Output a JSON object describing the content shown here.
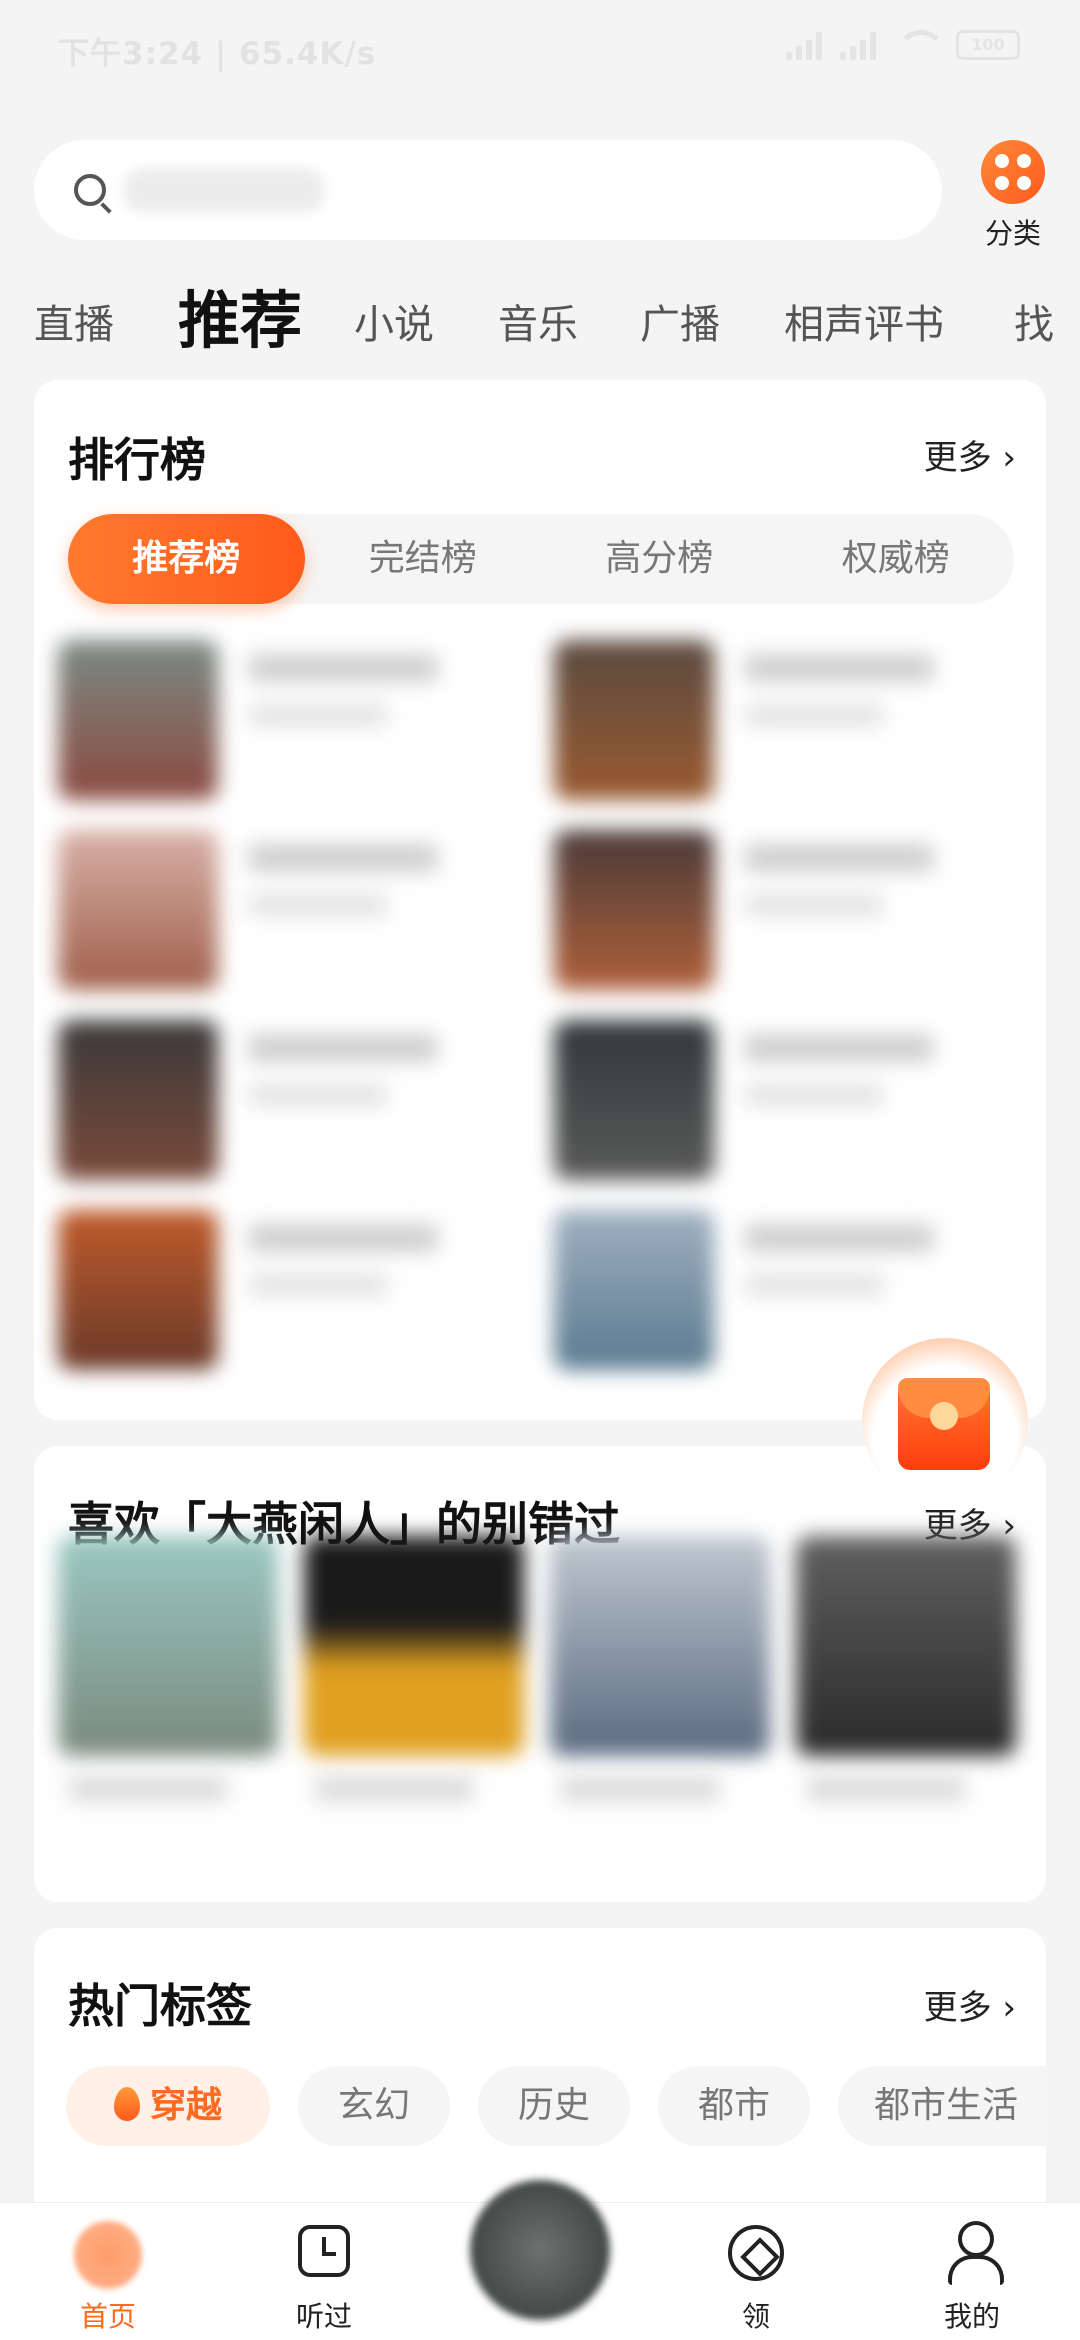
{
  "status_bar": {
    "time_speed": "下午3:24 | 65.4K/s",
    "battery": "100"
  },
  "search": {
    "placeholder": ""
  },
  "category": {
    "label": "分类"
  },
  "tabs": [
    "直播",
    "推荐",
    "小说",
    "音乐",
    "广播",
    "相声评书",
    "找"
  ],
  "ranking": {
    "title": "排行榜",
    "more": "更多",
    "segments": [
      "推荐榜",
      "完结榜",
      "高分榜",
      "权威榜"
    ],
    "active_segment": 0
  },
  "recommend": {
    "title": "喜欢「大燕闲人」的别错过",
    "more": "更多"
  },
  "hot_tags": {
    "title": "热门标签",
    "more": "更多",
    "tags": [
      "穿越",
      "玄幻",
      "历史",
      "都市",
      "都市生活"
    ]
  },
  "bottom_nav": {
    "items": [
      "首页",
      "听过",
      "",
      "领",
      "我的"
    ],
    "active": 0
  },
  "colors": {
    "accent": "#ff6a1f",
    "background": "#f4f4f4",
    "card": "#ffffff"
  },
  "icons": [
    "search-icon",
    "category-icon",
    "gift-icon",
    "home-icon",
    "history-icon",
    "discover-icon",
    "profile-icon",
    "flame-icon"
  ]
}
